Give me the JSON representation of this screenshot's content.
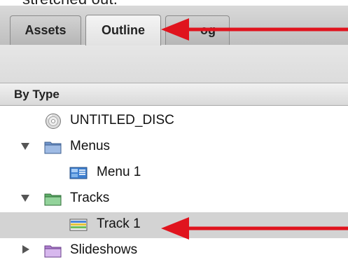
{
  "caption": "stretched out.",
  "tabs": [
    {
      "label": "Assets"
    },
    {
      "label": "Outline",
      "selected": true
    },
    {
      "label": "og"
    }
  ],
  "list_header": "By Type",
  "rows": [
    {
      "label": "UNTITLED_DISC",
      "icon": "disc-icon"
    },
    {
      "label": "Menus",
      "icon": "folder-blue-icon",
      "expanded": true
    },
    {
      "label": "Menu 1",
      "icon": "menu-icon"
    },
    {
      "label": "Tracks",
      "icon": "folder-green-icon",
      "expanded": true
    },
    {
      "label": "Track 1",
      "icon": "track-icon",
      "selected": true
    },
    {
      "label": "Slideshows",
      "icon": "folder-purple-icon",
      "expanded": false
    }
  ],
  "colors": {
    "annotation_arrow": "#e0141e",
    "selection": "#d3d3d3"
  }
}
